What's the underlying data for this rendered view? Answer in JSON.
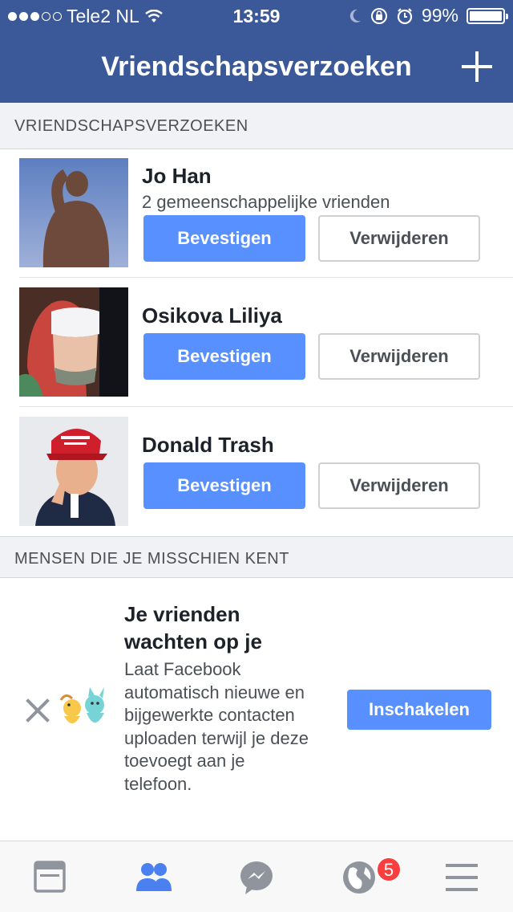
{
  "status_bar": {
    "carrier": "Tele2 NL",
    "time": "13:59",
    "battery": "99%",
    "battery_level": 0.99
  },
  "header": {
    "title": "Vriendschapsverzoeken",
    "add_icon": "plus-icon"
  },
  "requests_section": {
    "title": "VRIENDSCHAPSVERZOEKEN",
    "items": [
      {
        "name": "Jo Han",
        "mutual": "2 gemeenschappelijke vrienden",
        "confirm": "Bevestigen",
        "delete": "Verwijderen"
      },
      {
        "name": "Osikova Liliya",
        "mutual": "",
        "confirm": "Bevestigen",
        "delete": "Verwijderen"
      },
      {
        "name": "Donald Trash",
        "mutual": "",
        "confirm": "Bevestigen",
        "delete": "Verwijderen"
      }
    ]
  },
  "pymk_section": {
    "title": "MENSEN DIE JE MISSCHIEN KENT",
    "card_title": "Je vrienden wachten op je",
    "description": "Laat Facebook automatisch nieuwe en bijgewerkte contacten uploaden terwijl je deze toevoegt aan je telefoon.",
    "enable": "Inschakelen"
  },
  "tab_bar": {
    "tabs": [
      "news-feed-icon",
      "friend-requests-icon",
      "messenger-icon",
      "notifications-globe-icon",
      "menu-icon"
    ],
    "notifications_badge": "5"
  },
  "colors": {
    "brand": "#3b5998",
    "button": "#5890ff",
    "badge": "#fa3e3e"
  }
}
